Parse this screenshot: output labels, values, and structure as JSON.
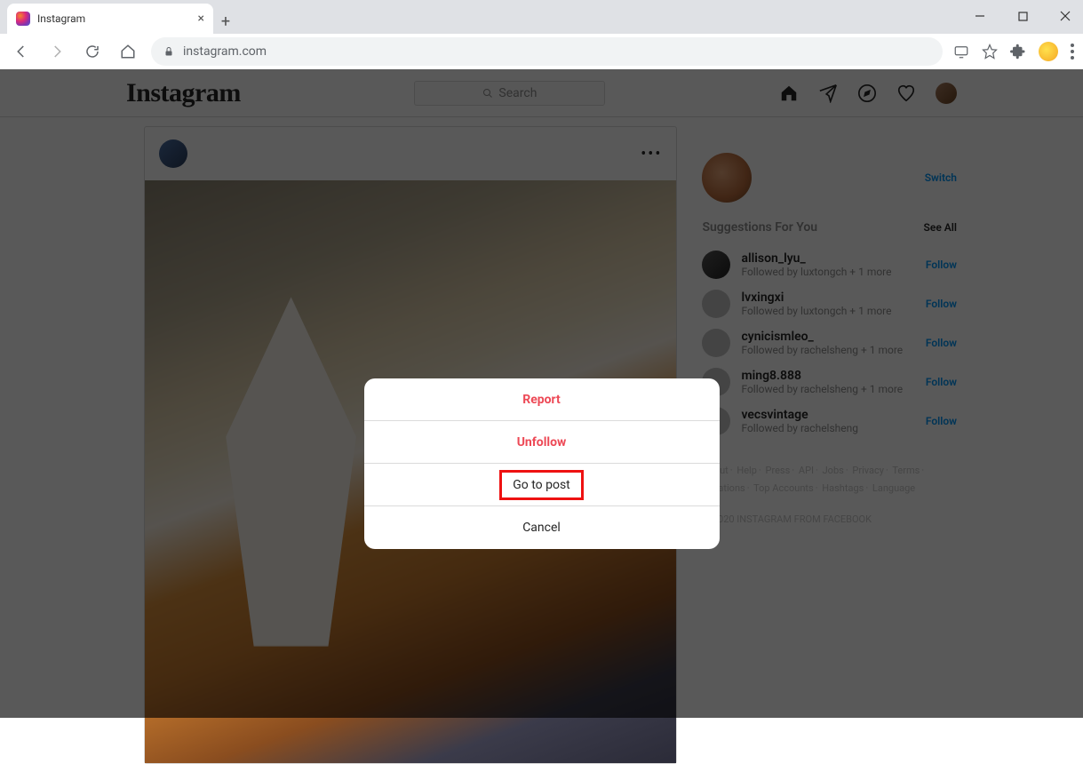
{
  "browser": {
    "tab_title": "Instagram",
    "url": "instagram.com",
    "new_tab_label": "+",
    "close_tab_label": "×"
  },
  "ig": {
    "logo": "Instagram",
    "search_placeholder": "Search"
  },
  "profile": {
    "switch_label": "Switch"
  },
  "suggestions": {
    "header": "Suggestions For You",
    "see_all": "See All",
    "follow_label": "Follow",
    "items": [
      {
        "username": "allison_lyu_",
        "meta": "Followed by luxtongch + 1 more"
      },
      {
        "username": "lvxingxi",
        "meta": "Followed by luxtongch + 1 more"
      },
      {
        "username": "cynicismleo_",
        "meta": "Followed by rachelsheng + 1 more"
      },
      {
        "username": "ming8.888",
        "meta": "Followed by rachelsheng + 1 more"
      },
      {
        "username": "vecsvintage",
        "meta": "Followed by rachelsheng"
      }
    ]
  },
  "footer": {
    "links": [
      "About",
      "Help",
      "Press",
      "API",
      "Jobs",
      "Privacy",
      "Terms",
      "Locations",
      "Top Accounts",
      "Hashtags",
      "Language"
    ],
    "copyright": "© 2020 INSTAGRAM FROM FACEBOOK"
  },
  "modal": {
    "report": "Report",
    "unfollow": "Unfollow",
    "goto": "Go to post",
    "cancel": "Cancel"
  }
}
